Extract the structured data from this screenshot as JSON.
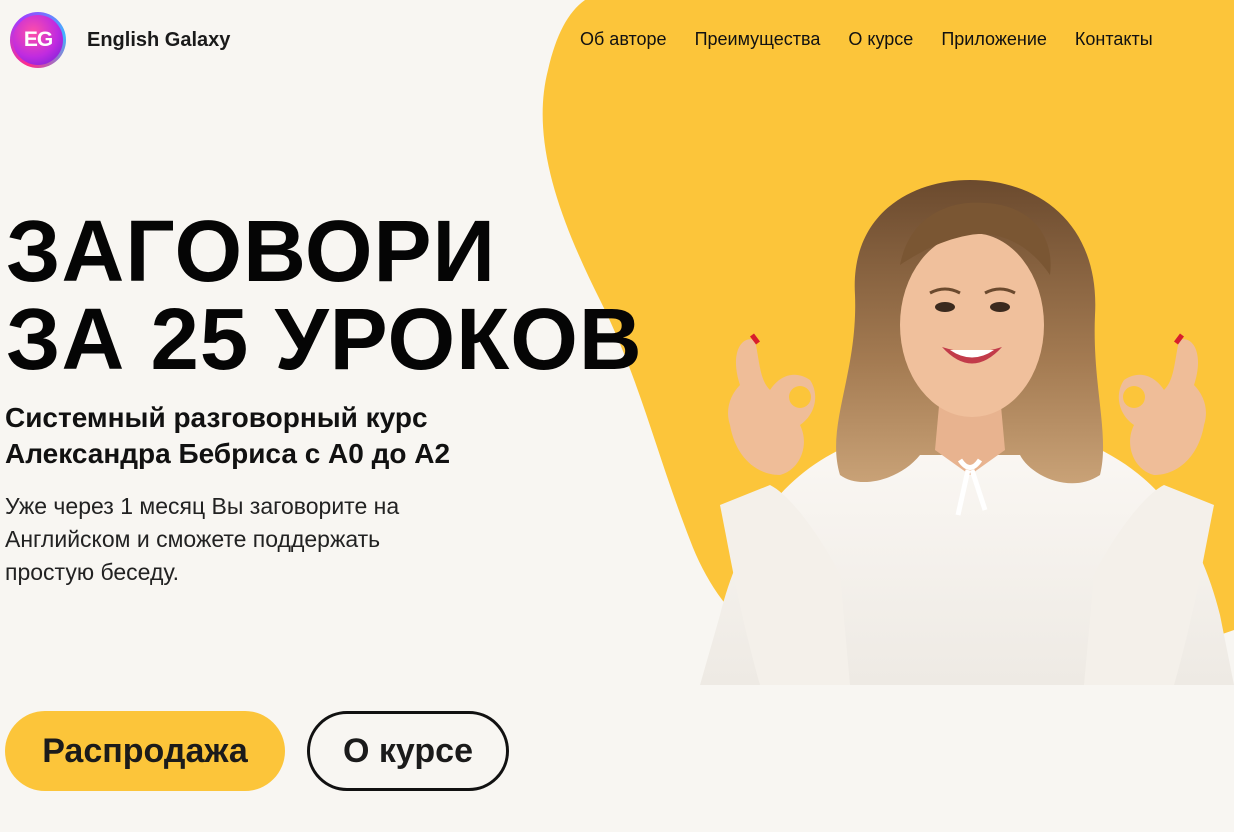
{
  "brand": {
    "logo_text": "EG",
    "name": "English Galaxy"
  },
  "nav": {
    "items": [
      "Об авторе",
      "Преимущества",
      "О курсе",
      "Приложение",
      "Контакты"
    ]
  },
  "hero": {
    "headline_line1": "ЗАГОВОРИ",
    "headline_line2": "ЗА 25 УРОКОВ",
    "subtitle_line1": "Системный разговорный курс",
    "subtitle_line2": "Александра Бебриса с A0 до A2",
    "description_line1": "Уже через 1 месяц Вы заговорите на",
    "description_line2": "Английском и сможете поддержать",
    "description_line3": "простую беседу."
  },
  "buttons": {
    "sale": "Распродажа",
    "course": "О курсе"
  },
  "colors": {
    "accent_yellow": "#fcc53a",
    "background": "#f8f6f2",
    "text": "#111111"
  },
  "image": {
    "subject": "smiling-woman-ok-gesture"
  }
}
